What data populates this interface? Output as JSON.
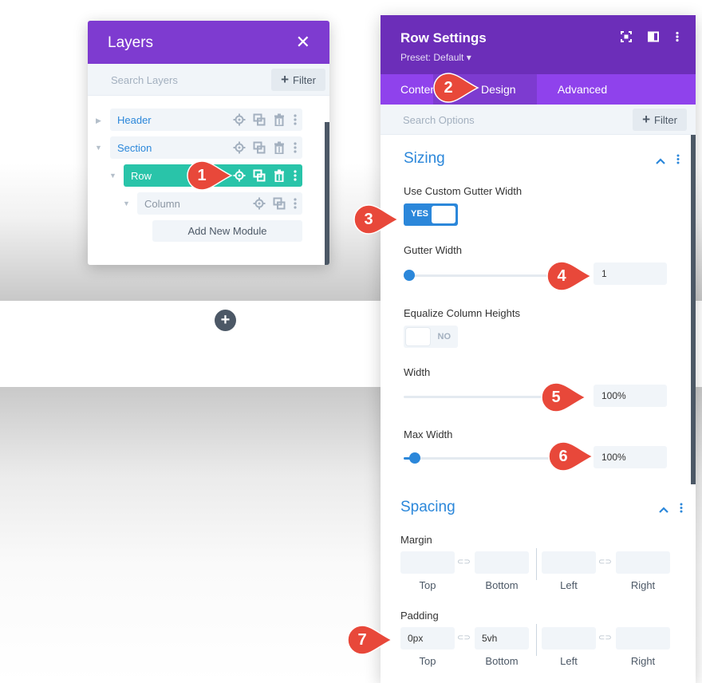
{
  "canvas": {
    "add_section_icon": "plus-icon"
  },
  "layers_panel": {
    "title": "Layers",
    "close_icon": "close-icon",
    "search_placeholder": "Search Layers",
    "filter_label": "Filter",
    "items": [
      {
        "label": "Header",
        "active": false
      },
      {
        "label": "Section",
        "active": false
      },
      {
        "label": "Row",
        "active": true
      },
      {
        "label": "Column",
        "active": false
      }
    ],
    "add_module_label": "Add New Module"
  },
  "settings_panel": {
    "title": "Row Settings",
    "preset": "Preset: Default ▾",
    "tabs": [
      {
        "label": "Content",
        "active": false
      },
      {
        "label": "Design",
        "active": true
      },
      {
        "label": "Advanced",
        "active": false
      }
    ],
    "search_placeholder": "Search Options",
    "filter_label": "Filter",
    "sizing": {
      "title": "Sizing",
      "use_custom_gutter": {
        "label": "Use Custom Gutter Width",
        "state": "YES"
      },
      "gutter_width": {
        "label": "Gutter Width",
        "value": "1",
        "level": 0.0
      },
      "equalize": {
        "label": "Equalize Column Heights",
        "state": "NO"
      },
      "width": {
        "label": "Width",
        "value": "100%"
      },
      "max_width": {
        "label": "Max Width",
        "value": "100%",
        "level": 0.04
      }
    },
    "spacing": {
      "title": "Spacing",
      "margin": {
        "label": "Margin",
        "fields": [
          {
            "caption": "Top",
            "value": ""
          },
          {
            "caption": "Bottom",
            "value": ""
          },
          {
            "caption": "Left",
            "value": ""
          },
          {
            "caption": "Right",
            "value": ""
          }
        ]
      },
      "padding": {
        "label": "Padding",
        "fields": [
          {
            "caption": "Top",
            "value": "0px"
          },
          {
            "caption": "Bottom",
            "value": "5vh"
          },
          {
            "caption": "Left",
            "value": ""
          },
          {
            "caption": "Right",
            "value": ""
          }
        ]
      },
      "link_glyph": "⊂⊃"
    }
  },
  "markers": [
    "1",
    "2",
    "3",
    "4",
    "5",
    "6",
    "7"
  ],
  "colors": {
    "purple_header": "#7e3bd0",
    "purple_tabs": "#8f42ec",
    "accent_blue": "#2b87da",
    "teal_active": "#29c4a9",
    "marker_red": "#e8483a"
  }
}
